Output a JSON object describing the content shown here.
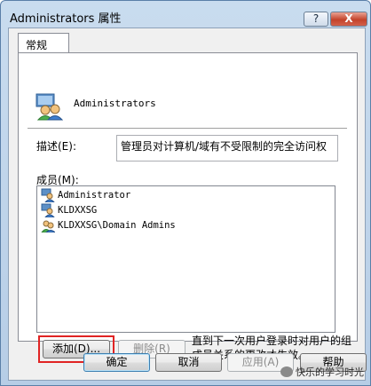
{
  "window": {
    "title": "Administrators 属性",
    "help_button": "?",
    "close_button": "X"
  },
  "tabs": [
    {
      "label": "常规"
    }
  ],
  "group": {
    "name": "Administrators"
  },
  "description": {
    "label": "描述(E):",
    "value": "管理员对计算机/域有不受限制的完全访问权"
  },
  "members": {
    "label": "成员(M):",
    "items": [
      {
        "name": "Administrator",
        "icon": "user-icon"
      },
      {
        "name": "KLDXXSG",
        "icon": "user-icon"
      },
      {
        "name": "KLDXXSG\\Domain Admins",
        "icon": "group-icon"
      }
    ]
  },
  "actions": {
    "add": "添加(D)...",
    "remove": "删除(R)"
  },
  "note": "直到下一次用户登录时对用户的组成员关系的更改才生效。",
  "dialog_buttons": {
    "ok": "确定",
    "cancel": "取消",
    "apply": "应用(A)",
    "help": "帮助"
  },
  "watermark": "快乐的学习时光",
  "colors": {
    "highlight": "#e02424",
    "title_bar": "#c9dcef",
    "close_button": "#c4432b"
  }
}
